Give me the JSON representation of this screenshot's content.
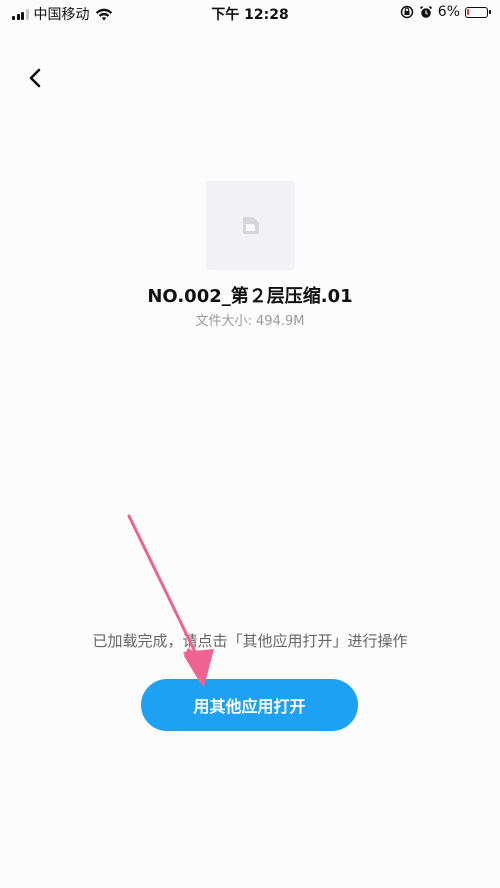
{
  "status_bar": {
    "carrier": "中国移动",
    "time": "下午 12:28",
    "battery": "6%",
    "battery_level": 0.06,
    "icons": [
      "signal-icon",
      "wifi-icon",
      "lock-rotation-icon",
      "alarm-icon",
      "battery-icon"
    ]
  },
  "nav": {
    "back_icon": "chevron-left-icon"
  },
  "file": {
    "name": "NO.002_第２层压缩.01",
    "size_text": "文件大小: 494.9M",
    "icon": "file-icon"
  },
  "hint": "已加载完成，请点击「其他应用打开」进行操作",
  "open_button": {
    "label": "用其他应用打开",
    "color": "#1da1f2"
  },
  "annotation": {
    "color": "#f06292",
    "icon": "pink-arrow-icon"
  }
}
